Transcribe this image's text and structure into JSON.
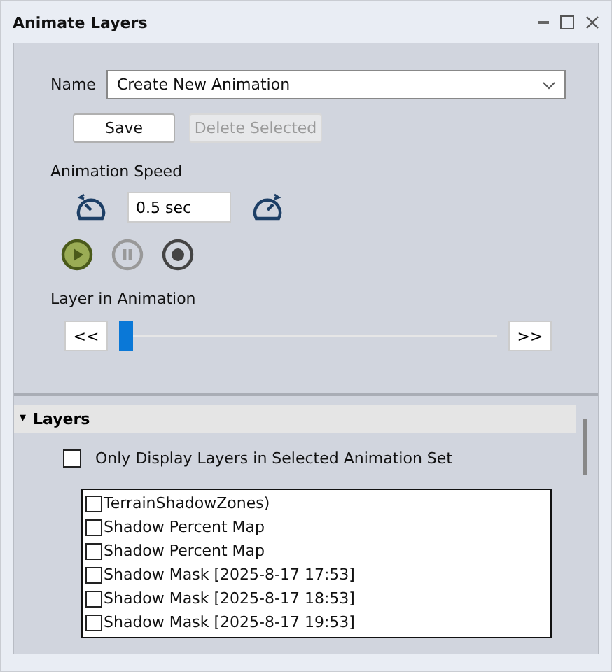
{
  "window": {
    "title": "Animate Layers"
  },
  "name_field": {
    "label": "Name",
    "value": "Create New Animation"
  },
  "buttons": [
    {
      "label": "Save",
      "disabled": false
    },
    {
      "label": "Delete Selected",
      "disabled": true
    }
  ],
  "speed": {
    "label": "Animation Speed",
    "value": "0.5 sec"
  },
  "playback": [
    {
      "kind": "play",
      "active": true,
      "disabled": false
    },
    {
      "kind": "pause",
      "active": false,
      "disabled": true
    },
    {
      "kind": "stop",
      "active": false,
      "disabled": false
    }
  ],
  "layer_slider": {
    "label": "Layer in Animation",
    "prev": "<<",
    "next": ">>",
    "level": 0
  },
  "layers_section": {
    "title": "Layers",
    "expanded": true,
    "expander": "▾",
    "filter": {
      "label": "Only Display Layers in Selected Animation Set",
      "checked": false
    },
    "items": [
      {
        "label": "TerrainShadowZones)",
        "checked": false
      },
      {
        "label": "Shadow Percent Map",
        "checked": false
      },
      {
        "label": "Shadow Percent Map",
        "checked": false
      },
      {
        "label": "Shadow Mask [2025-8-17 17:53]",
        "checked": false
      },
      {
        "label": "Shadow Mask [2025-8-17 18:53]",
        "checked": false
      },
      {
        "label": "Shadow Mask [2025-8-17 19:53]",
        "checked": false
      }
    ]
  }
}
